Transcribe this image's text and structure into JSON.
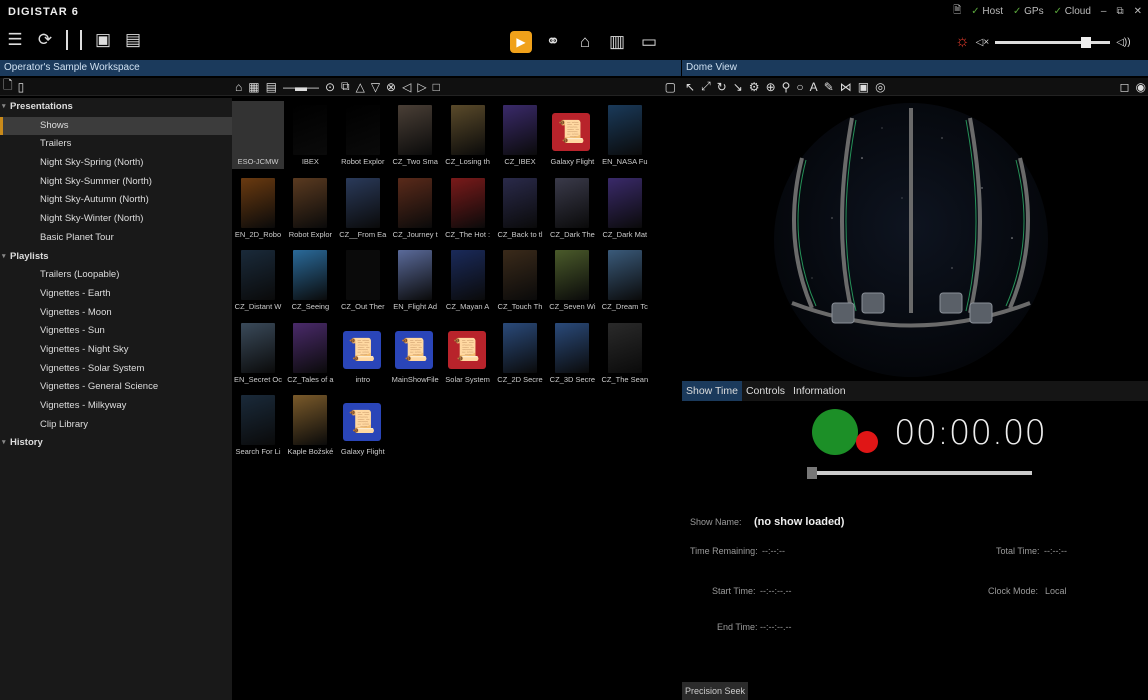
{
  "app": {
    "title": "DIGISTAR 6"
  },
  "status": {
    "host": "Host",
    "gps": "GPs",
    "cloud": "Cloud"
  },
  "workspace_title": "Operator's Sample Workspace",
  "dome_title": "Dome View",
  "tree": {
    "groups": [
      {
        "label": "Presentations",
        "items": [
          "Shows",
          "Trailers",
          "Night Sky-Spring (North)",
          "Night Sky-Summer (North)",
          "Night Sky-Autumn (North)",
          "Night Sky-Winter (North)",
          "Basic Planet Tour"
        ]
      },
      {
        "label": "Playlists",
        "items": [
          "Trailers (Loopable)",
          "Vignettes - Earth",
          "Vignettes - Moon",
          "Vignettes - Sun",
          "Vignettes - Night Sky",
          "Vignettes - Solar System",
          "Vignettes - General Science",
          "Vignettes - Milkyway",
          "Clip Library"
        ]
      },
      {
        "label": "History",
        "items": []
      }
    ],
    "selected": "Shows"
  },
  "thumbnails": [
    {
      "label": "ESO-JCMW",
      "color": "#3a3a3a"
    },
    {
      "label": "IBEX",
      "color": "#000000"
    },
    {
      "label": "Robot Explor",
      "color": "#000000"
    },
    {
      "label": "CZ_Two Sma",
      "color": "#4a3f36"
    },
    {
      "label": "CZ_Losing th",
      "color": "#5a4a2a"
    },
    {
      "label": "CZ_IBEX",
      "color": "#3a2a6a"
    },
    {
      "label": "Galaxy Flight",
      "color": "#b8232b",
      "icon": "scroll"
    },
    {
      "label": "EN_NASA Fu",
      "color": "#1a3a5a"
    },
    {
      "label": "EN_2D_Robo",
      "color": "#6a3a10"
    },
    {
      "label": "Robot Explor",
      "color": "#5a3a20"
    },
    {
      "label": "CZ__From Ea",
      "color": "#2a3a5a"
    },
    {
      "label": "CZ_Journey t",
      "color": "#5a2a1a"
    },
    {
      "label": "CZ_The Hot :",
      "color": "#7a1a1a"
    },
    {
      "label": "CZ_Back to tl",
      "color": "#2a2a4a"
    },
    {
      "label": "CZ_Dark The",
      "color": "#3a3a4a"
    },
    {
      "label": "CZ_Dark Mat",
      "color": "#3a2a6a"
    },
    {
      "label": "CZ_Distant W",
      "color": "#1a2a3a"
    },
    {
      "label": "CZ_Seeing",
      "color": "#2a6a9a"
    },
    {
      "label": "CZ_Out Ther",
      "color": "#0a0a0a"
    },
    {
      "label": "EN_Flight Ad",
      "color": "#5a6a9a"
    },
    {
      "label": "CZ_Mayan A",
      "color": "#1a2a5a"
    },
    {
      "label": "CZ_Touch Th",
      "color": "#3a2a1a"
    },
    {
      "label": "CZ_Seven Wi",
      "color": "#4a5a2a"
    },
    {
      "label": "CZ_Dream Tc",
      "color": "#3a5a7a"
    },
    {
      "label": "EN_Secret Oc",
      "color": "#3a4a5a"
    },
    {
      "label": "CZ_Tales of a",
      "color": "#4a2a6a"
    },
    {
      "label": "intro",
      "color": "#2a45b8",
      "icon": "scroll-play"
    },
    {
      "label": "MainShowFile",
      "color": "#2a45b8",
      "icon": "scroll-play"
    },
    {
      "label": "Solar System",
      "color": "#b8232b",
      "icon": "scroll"
    },
    {
      "label": "CZ_2D Secre",
      "color": "#2a4a7a"
    },
    {
      "label": "CZ_3D Secre",
      "color": "#2a4a7a"
    },
    {
      "label": "CZ_The Sean",
      "color": "#2a2a2a"
    },
    {
      "label": "Search For Li",
      "color": "#1a2a3a"
    },
    {
      "label": "Kaple Božské",
      "color": "#7a5a2a"
    },
    {
      "label": "Galaxy Flight",
      "color": "#2a45b8",
      "icon": "scroll-play"
    }
  ],
  "tabs": [
    "Show Time",
    "Controls",
    "Information"
  ],
  "active_tab": "Show Time",
  "show": {
    "timer": "00:00.00",
    "seek_progress": 0,
    "name_label": "Show Name:",
    "name_value": "(no show loaded)",
    "remaining_label": "Time Remaining:",
    "remaining_value": "--:--:--",
    "total_label": "Total Time:",
    "total_value": "--:--:--",
    "start_label": "Start Time:",
    "start_value": "--:--:--.--",
    "clock_label": "Clock Mode:",
    "clock_value": "Local",
    "end_label": "End Time:",
    "end_value": "--:--:--.--"
  },
  "precision_seek": "Precision Seek",
  "colors": {
    "accent": "#f0a11a",
    "panel_title": "#1b3a5c",
    "ok": "#5aa63c",
    "record": "#e01616",
    "go": "#1c8f27"
  }
}
